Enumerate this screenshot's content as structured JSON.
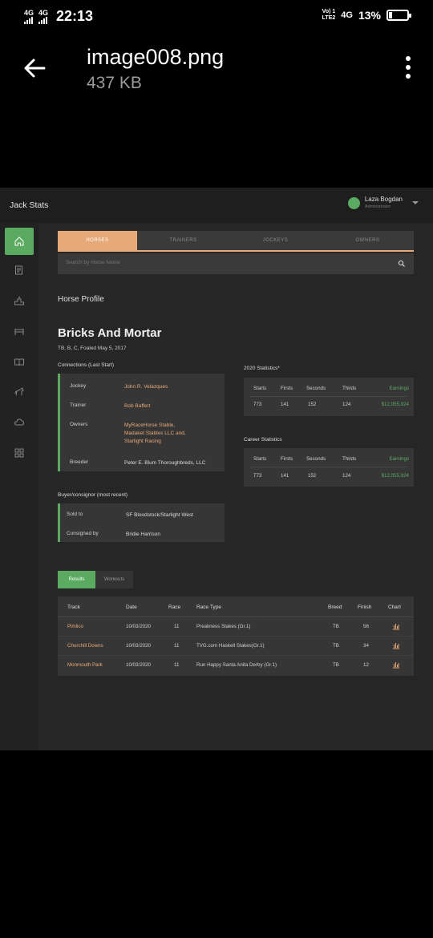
{
  "status_bar": {
    "sim1": "4G",
    "sim2": "4G",
    "time": "22:13",
    "volte_top": "Vo) 1",
    "volte_bottom": "LTE2",
    "network": "4G",
    "battery": "13%"
  },
  "viewer": {
    "file_name": "image008.png",
    "file_size": "437 KB"
  },
  "app": {
    "brand": "Jack Stats",
    "user_name": "Laza Bogdan",
    "user_role": "Administrator",
    "sidebar_icons": [
      "home-icon",
      "notes-icon",
      "podium-icon",
      "hurdle-icon",
      "book-icon",
      "horse-icon",
      "cloud-icon",
      "grid-icon"
    ],
    "tabs": [
      "HORSES",
      "TRAINERS",
      "JOCKEYS",
      "OWNERS"
    ],
    "search_placeholder": "Search by Horse Name",
    "section_title": "Horse Profile",
    "horse": {
      "name": "Bricks And Mortar",
      "description": "TB, B, C, Foaled May 5, 2017"
    },
    "connections": {
      "title": "Connections (Last Start)",
      "jockey_label": "Jockey",
      "jockey": "John R. Velazques",
      "trainer_label": "Trainer",
      "trainer": "Bob Baffert",
      "owners_label": "Owners",
      "owners_line1": "MyRaceHorse Stable,",
      "owners_line2": "Madaket Stables LLC and,",
      "owners_line3": "Starlight Racing",
      "breeder_label": "Breeder",
      "breeder": "Peter E. Blum Thoroughbreds, LLC"
    },
    "buyer": {
      "title": "Buyer/consignor (most recent)",
      "sold_to_label": "Sold to",
      "sold_to": "SF Bloodstock/Starlight West",
      "consigned_label": "Consigned by",
      "consigned": "Bridie Harrison"
    },
    "stats_2020": {
      "title": "2020 Statistics*",
      "headers": [
        "Starts",
        "Firsts",
        "Seconds",
        "Thirds",
        "Earnings"
      ],
      "values": [
        "773",
        "141",
        "152",
        "124",
        "$12,055,924"
      ]
    },
    "career_stats": {
      "title": "Career Statistics",
      "headers": [
        "Starts",
        "Firsts",
        "Seconds",
        "Thirds",
        "Earnings"
      ],
      "values": [
        "773",
        "141",
        "152",
        "124",
        "$12,055,924"
      ]
    },
    "result_tabs": [
      "Results",
      "Workouts"
    ],
    "results": {
      "headers": [
        "Track",
        "Date",
        "Race",
        "Race Type",
        "Breed",
        "Finish",
        "Chart"
      ],
      "rows": [
        {
          "track": "Pimlico",
          "date": "10/03/2020",
          "race": "11",
          "race_type": "Preakness Stakes (Gr.1)",
          "breed": "TB",
          "finish": "56"
        },
        {
          "track": "Churchill Downs",
          "date": "10/03/2020",
          "race": "11",
          "race_type": "TVG.com Haskell Stakes(Gr.1)",
          "breed": "TB",
          "finish": "34"
        },
        {
          "track": "Monmouth Park",
          "date": "10/03/2020",
          "race": "11",
          "race_type": "Run Happy Santa Anita Derby (Gr.1)",
          "breed": "TB",
          "finish": "12"
        }
      ]
    },
    "colors": {
      "accent_orange": "#e8a978",
      "accent_green": "#5aaa62",
      "panel": "#363636",
      "background": "#262626"
    }
  }
}
